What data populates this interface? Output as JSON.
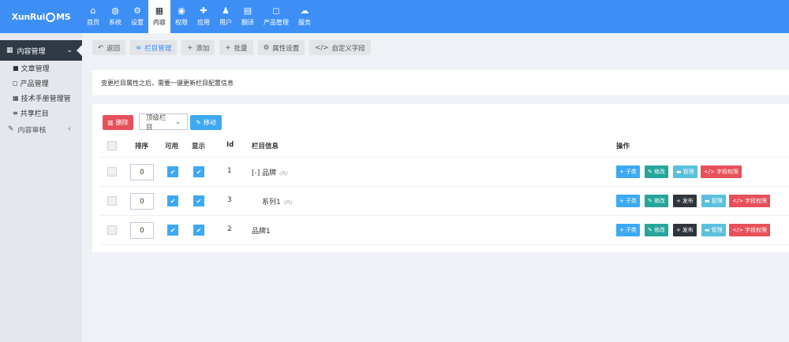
{
  "logo": {
    "pre": "XunRui",
    "post": "MS"
  },
  "nav": [
    {
      "label": "首页",
      "icon": "home-icon",
      "glyph": "⌂"
    },
    {
      "label": "系统",
      "icon": "globe-icon",
      "glyph": "◍"
    },
    {
      "label": "设置",
      "icon": "cogs-icon",
      "glyph": "⚙"
    },
    {
      "label": "内容",
      "icon": "grid-icon",
      "glyph": "▦"
    },
    {
      "label": "权限",
      "icon": "user-circle-icon",
      "glyph": "◉"
    },
    {
      "label": "应用",
      "icon": "puzzle-icon",
      "glyph": "✚"
    },
    {
      "label": "用户",
      "icon": "user-icon",
      "glyph": "♟"
    },
    {
      "label": "翻译",
      "icon": "book-icon",
      "glyph": "▤"
    },
    {
      "label": "产品管理",
      "icon": "bag-icon",
      "glyph": "◻"
    },
    {
      "label": "服务",
      "icon": "cloud-icon",
      "glyph": "☁"
    }
  ],
  "sidebar": {
    "header": "内容管理",
    "items": [
      {
        "label": "文章管理",
        "glyph": "■"
      },
      {
        "label": "产品管理",
        "glyph": "◻"
      },
      {
        "label": "技术手册管理管",
        "glyph": "▦"
      },
      {
        "label": "共享栏目",
        "glyph": "≡"
      }
    ],
    "group": "内容审核"
  },
  "toolbar": {
    "back": "返回",
    "columns": "栏目管理",
    "add": "添加",
    "batch": "批量",
    "attr": "属性设置",
    "fields": "自定义字段"
  },
  "notice": "变更栏目属性之后，需要一键更新栏目配置信息",
  "actions": {
    "delete": "删除",
    "select": "顶级栏目",
    "move": "移动"
  },
  "table": {
    "headers": {
      "sort": "排序",
      "usable": "可用",
      "show": "显示",
      "id": "Id",
      "info": "栏目信息",
      "op": "操作"
    },
    "rows": [
      {
        "sort": "0",
        "id": "1",
        "name": "[-] 品牌",
        "tag": "(内)"
      },
      {
        "sort": "0",
        "id": "3",
        "name": "系列1",
        "tag": "(内)"
      },
      {
        "sort": "0",
        "id": "2",
        "name": "品牌1",
        "tag": ""
      }
    ],
    "btns": {
      "child": "子类",
      "edit": "修改",
      "publish": "发布",
      "manage": "管理",
      "perm": "字段权限"
    }
  }
}
